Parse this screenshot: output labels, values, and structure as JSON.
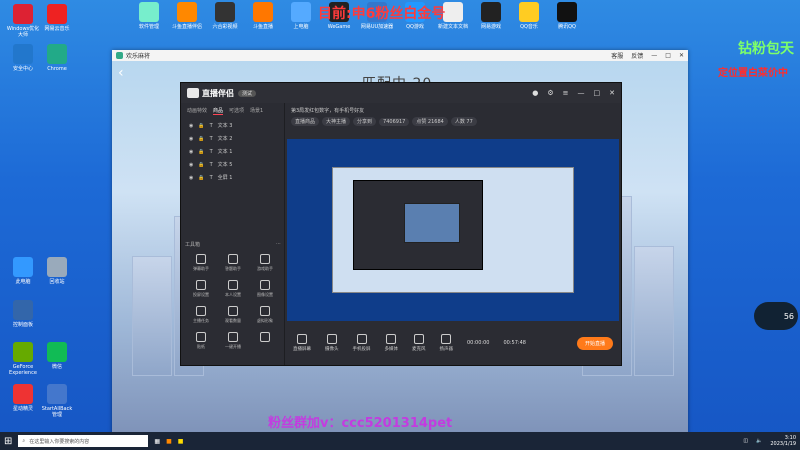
{
  "overlay": {
    "top_banner": "目前:申6粉丝白金号",
    "right_title": "钻粉包天",
    "right_sub": "定位置白菜价中",
    "bottom_watermark": "粉丝群加v：ccc5201314pet"
  },
  "desktop_icons": [
    {
      "label": "Windows优化大师",
      "color": "#d23"
    },
    {
      "label": "网易云音乐",
      "color": "#e22"
    },
    {
      "label": "安全中心",
      "color": "#27c"
    },
    {
      "label": "Chrome",
      "color": "#2a8"
    },
    {
      "label": "此电脑",
      "color": "#39f"
    },
    {
      "label": "回收站",
      "color": "#9ab"
    },
    {
      "label": "控制面板",
      "color": "#36a"
    },
    {
      "label": "GeForce Experience",
      "color": "#6a0"
    },
    {
      "label": "微信",
      "color": "#1b5"
    },
    {
      "label": "星动精灵",
      "color": "#e33"
    },
    {
      "label": "StartAllBack 管理",
      "color": "#47c"
    }
  ],
  "top_icons": [
    {
      "label": "软件管理",
      "color": "#7ec"
    },
    {
      "label": "斗鱼直播伴侣",
      "color": "#f80"
    },
    {
      "label": "六合彩视频",
      "color": "#333"
    },
    {
      "label": "斗鱼直播",
      "color": "#f70"
    },
    {
      "label": "上电脑",
      "color": "#5af"
    },
    {
      "label": "WeGame",
      "color": "#222"
    },
    {
      "label": "网易UU加速器",
      "color": "#37c"
    },
    {
      "label": "QQ游戏",
      "color": "#29f"
    },
    {
      "label": "新建文本文档",
      "color": "#eee"
    },
    {
      "label": "网易游戏",
      "color": "#222"
    },
    {
      "label": "QQ音乐",
      "color": "#fc2"
    },
    {
      "label": "腾讯QQ",
      "color": "#111"
    }
  ],
  "app": {
    "title": "欢乐麻将",
    "actions": [
      "客服",
      "反馈",
      "—",
      "□",
      "✕"
    ],
    "matching": "匹配中 20"
  },
  "studio": {
    "name": "直播伴侣",
    "badge": "测试",
    "tabs": [
      "动画特效",
      "商品",
      "可选项",
      "场景1"
    ],
    "sources": [
      "文本 3",
      "文本 2",
      "文本 1",
      "文本 5",
      "全屏 1"
    ],
    "tools_title": "工具箱",
    "tools": [
      "弹幕助手",
      "答题助手",
      "游戏助手",
      "投屏设置",
      "本人设置",
      "图像设置",
      "主播任务",
      "观看数量",
      "虚拟形象",
      "贴纸",
      "一键开播",
      ""
    ],
    "info_line": "第3局发红包数字，有手机号好友",
    "chips": [
      "直播商品",
      "大神主播",
      "分享到",
      "7406917",
      "点赞 21684",
      "人数 77"
    ],
    "bottom_tools": [
      "直播屏幕",
      "摄像头",
      "手机投屏",
      "多媒体",
      "麦克风",
      "扬声器"
    ],
    "timer1": "00:00:00",
    "timer2": "00:57:48",
    "go_live": "开始直播"
  },
  "taskbar": {
    "search_placeholder": "在这里输入你要搜索的内容",
    "time": "3:10",
    "date": "2023/1/19",
    "widget_pct": "56"
  }
}
